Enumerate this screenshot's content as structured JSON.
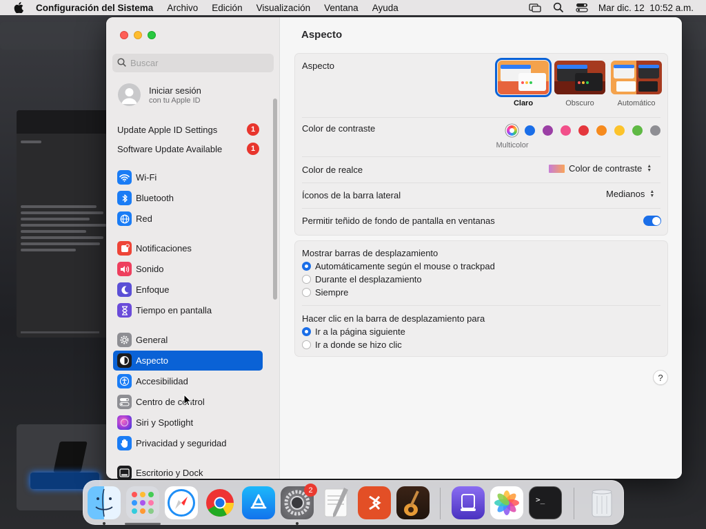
{
  "menubar": {
    "app_name": "Configuración del Sistema",
    "menus": [
      "Archivo",
      "Edición",
      "Visualización",
      "Ventana",
      "Ayuda"
    ],
    "clock": "Mar dic. 12  10:52 a.m."
  },
  "sidebar": {
    "search_placeholder": "Buscar",
    "account": {
      "title": "Iniciar sesión",
      "subtitle": "con tu Apple ID"
    },
    "notices": [
      {
        "label": "Update Apple ID Settings",
        "badge": "1"
      },
      {
        "label": "Software Update Available",
        "badge": "1"
      }
    ],
    "items": [
      {
        "label": "Wi-Fi",
        "icon": "wifi-icon",
        "color": "#1a7cf5"
      },
      {
        "label": "Bluetooth",
        "icon": "bluetooth-icon",
        "color": "#1a7cf5"
      },
      {
        "label": "Red",
        "icon": "globe-icon",
        "color": "#1a7cf5"
      },
      {
        "label": "Notificaciones",
        "icon": "bell-icon",
        "color": "#ee4437"
      },
      {
        "label": "Sonido",
        "icon": "speaker-icon",
        "color": "#ee3f5e"
      },
      {
        "label": "Enfoque",
        "icon": "moon-icon",
        "color": "#5b4fd6"
      },
      {
        "label": "Tiempo en pantalla",
        "icon": "hourglass-icon",
        "color": "#6a4bd9"
      },
      {
        "label": "General",
        "icon": "gear-icon",
        "color": "#8e8e93"
      },
      {
        "label": "Aspecto",
        "icon": "appearance-icon",
        "color": "#1c1c1e"
      },
      {
        "label": "Accesibilidad",
        "icon": "accessibility-icon",
        "color": "#1a7cf5"
      },
      {
        "label": "Centro de control",
        "icon": "control-center-icon",
        "color": "#8e8e93"
      },
      {
        "label": "Siri y Spotlight",
        "icon": "siri-icon",
        "color": "#a03cd8"
      },
      {
        "label": "Privacidad y seguridad",
        "icon": "hand-icon",
        "color": "#1a7cf5"
      },
      {
        "label": "Escritorio y Dock",
        "icon": "dock-icon",
        "color": "#1c1c1e"
      }
    ]
  },
  "content": {
    "title": "Aspecto",
    "appearance": {
      "label": "Aspecto",
      "options": [
        {
          "label": "Claro",
          "selected": true
        },
        {
          "label": "Obscuro",
          "selected": false
        },
        {
          "label": "Automático",
          "selected": false
        }
      ]
    },
    "accent": {
      "label": "Color de contraste",
      "selected_name": "Multicolor",
      "colors": [
        "#multicolor",
        "#1a6ee8",
        "#9b3fa5",
        "#f2508a",
        "#e4373d",
        "#f68a1d",
        "#fcc32b",
        "#5fb944",
        "#8e8e93"
      ]
    },
    "highlight": {
      "label": "Color de realce",
      "value": "Color de contraste"
    },
    "sidebar_icons": {
      "label": "Íconos de la barra lateral",
      "value": "Medianos"
    },
    "tinting": {
      "label": "Permitir teñido de fondo de pantalla en ventanas",
      "on": true
    },
    "scrollbars": {
      "label": "Mostrar barras de desplazamiento",
      "options": [
        {
          "label": "Automáticamente según el mouse o trackpad",
          "selected": true
        },
        {
          "label": "Durante el desplazamiento",
          "selected": false
        },
        {
          "label": "Siempre",
          "selected": false
        }
      ]
    },
    "click_scroll": {
      "label": "Hacer clic en la barra de desplazamiento para",
      "options": [
        {
          "label": "Ir a la página siguiente",
          "selected": true
        },
        {
          "label": "Ir a donde se hizo clic",
          "selected": false
        }
      ]
    },
    "help": "?"
  },
  "dock": {
    "apps": [
      "finder-icon",
      "launchpad-icon",
      "safari-icon",
      "chrome-icon",
      "app-store-icon",
      "system-settings-icon",
      "textedit-icon",
      "remote-desktop-icon",
      "garageband-icon",
      "apple-configurator-icon",
      "photos-icon",
      "terminal-icon",
      "trash-icon"
    ],
    "settings_badge": "2"
  }
}
